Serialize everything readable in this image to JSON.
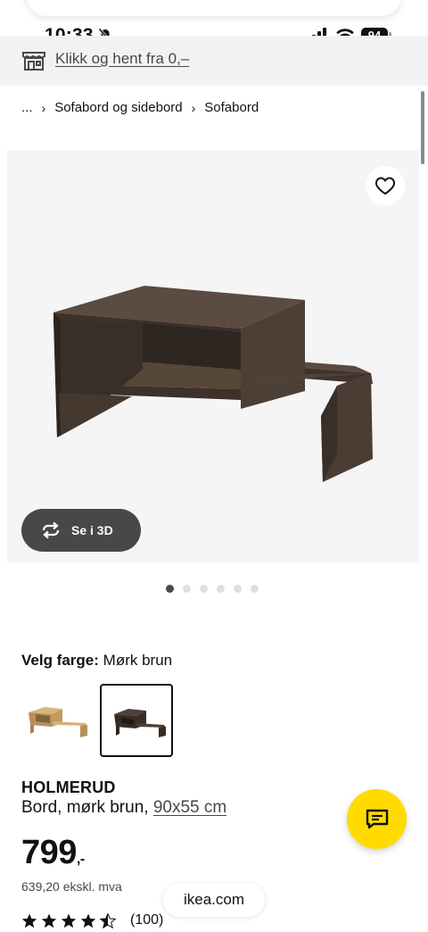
{
  "status_bar": {
    "time": "10:33",
    "battery": "94"
  },
  "banner": {
    "link_text": "Klikk og hent fra 0,–",
    "icon": "store-icon"
  },
  "breadcrumb": {
    "ellipsis": "...",
    "items": [
      "Sofabord og sidebord",
      "Sofabord"
    ]
  },
  "gallery": {
    "view_3d_label": "Se i 3D",
    "dots_count": 6,
    "active_dot": 0,
    "favorite_icon": "heart-icon"
  },
  "color_picker": {
    "label": "Velg farge:",
    "selected": "Mørk brun",
    "options": [
      "light-wood",
      "dark-brown"
    ]
  },
  "product": {
    "name": "HOLMERUD",
    "description": "Bord, mørk brun,",
    "dimensions": "90x55 cm",
    "price": "799",
    "price_suffix": ",-",
    "price_ex_vat": "639,20 ekskl. mva",
    "rating": 4.5,
    "review_count": "(100)"
  },
  "browser": {
    "url": "ikea.com"
  },
  "colors": {
    "accent_yellow": "#ffdb00",
    "dark_gray": "#484848",
    "wood_dark": "#4a3d34",
    "wood_light": "#c9a36b"
  }
}
